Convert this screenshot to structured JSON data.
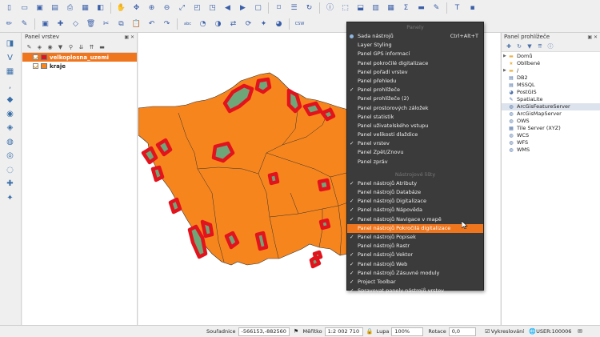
{
  "toolbar": {
    "row1_icons": [
      "new-project-icon",
      "open-project-icon",
      "save-project-icon",
      "save-as-icon",
      "print-layout-icon",
      "layout-manager-icon",
      "style-manager-icon",
      "pan-icon",
      "pan-to-selection-icon",
      "zoom-in-icon",
      "zoom-out-icon",
      "zoom-full-icon",
      "zoom-selection-icon",
      "zoom-layer-icon",
      "zoom-last-icon",
      "zoom-next-icon",
      "new-map-view-icon",
      "bookmark-icon",
      "show-bookmarks-icon",
      "refresh-icon",
      "identify-icon",
      "select-icon",
      "deselect-icon",
      "attribute-table-icon",
      "field-calculator-icon",
      "statistics-icon",
      "measure-icon",
      "annotation-icon",
      "text-annotation-icon",
      "python-icon"
    ],
    "row2_icons": [
      "digitize-icon",
      "toggle-edit-icon",
      "save-edits-icon",
      "add-point-icon",
      "vertex-tool-icon",
      "delete-icon",
      "cut-icon",
      "copy-icon",
      "paste-icon",
      "undo-icon",
      "redo-icon",
      "label-icon",
      "pin-labels-icon",
      "show-labels-icon",
      "move-label-icon",
      "rotate-label-icon",
      "change-label-icon",
      "diagram-icon",
      "csw-icon"
    ]
  },
  "left_tools": [
    "layer-manager-icon",
    "add-vector-icon",
    "add-raster-icon",
    "add-delimited-icon",
    "add-spatialite-icon",
    "add-postgis-icon",
    "add-mssql-icon",
    "add-wms-icon",
    "add-wcs-icon",
    "add-wfs-icon",
    "new-shapefile-icon",
    "new-spatialite-icon"
  ],
  "layers_panel": {
    "title": "Panel vrstev",
    "layers": [
      {
        "name": "velkoplosna_uzemi",
        "color": "#e2131c",
        "selected": true
      },
      {
        "name": "kraje",
        "color": "#f7851d",
        "selected": false
      }
    ]
  },
  "browser_panel": {
    "title": "Panel prohlížeče",
    "items": [
      {
        "label": "Domů",
        "icon": "folder-icon",
        "arrow": true
      },
      {
        "label": "Oblíbené",
        "icon": "star-icon",
        "arrow": false
      },
      {
        "label": "/",
        "icon": "folder-icon",
        "arrow": true
      },
      {
        "label": "DB2",
        "icon": "database-icon",
        "arrow": false
      },
      {
        "label": "MSSQL",
        "icon": "database-icon",
        "arrow": false
      },
      {
        "label": "PostGIS",
        "icon": "elephant-icon",
        "arrow": false
      },
      {
        "label": "SpatiaLite",
        "icon": "feather-icon",
        "arrow": false
      },
      {
        "label": "ArcGisFeatureServer",
        "icon": "globe-icon",
        "arrow": false,
        "selected": true
      },
      {
        "label": "ArcGisMapServer",
        "icon": "globe-icon",
        "arrow": false
      },
      {
        "label": "OWS",
        "icon": "globe-icon",
        "arrow": false
      },
      {
        "label": "Tile Server (XYZ)",
        "icon": "grid-icon",
        "arrow": false
      },
      {
        "label": "WCS",
        "icon": "globe-icon",
        "arrow": false
      },
      {
        "label": "WFS",
        "icon": "globe-icon",
        "arrow": false
      },
      {
        "label": "WMS",
        "icon": "globe-icon",
        "arrow": false
      }
    ]
  },
  "menu": {
    "header_panels": "Panely",
    "header_toolbars": "Nástrojové lišty",
    "items_panels": [
      {
        "label": "Sada nástrojů",
        "shortcut": "Ctrl+Alt+T",
        "mark": "radio"
      },
      {
        "label": "Layer Styling",
        "mark": ""
      },
      {
        "label": "Panel GPS informací",
        "mark": ""
      },
      {
        "label": "Panel pokročilé digitalizace",
        "mark": ""
      },
      {
        "label": "Panel pořadí vrstev",
        "mark": ""
      },
      {
        "label": "Panel přehledu",
        "mark": ""
      },
      {
        "label": "Panel prohlížeče",
        "mark": "check"
      },
      {
        "label": "Panel prohlížeče (2)",
        "mark": ""
      },
      {
        "label": "Panel prostorových záložek",
        "mark": ""
      },
      {
        "label": "Panel statistik",
        "mark": ""
      },
      {
        "label": "Panel uživatelského vstupu",
        "mark": ""
      },
      {
        "label": "Panel velikosti dlaždice",
        "mark": ""
      },
      {
        "label": "Panel vrstev",
        "mark": "check"
      },
      {
        "label": "Panel Zpět/Znovu",
        "mark": ""
      },
      {
        "label": "Panel zpráv",
        "mark": ""
      }
    ],
    "items_toolbars": [
      {
        "label": "Panel nástrojů Atributy",
        "mark": "check"
      },
      {
        "label": "Panel nástrojů Databáze",
        "mark": ""
      },
      {
        "label": "Panel nástrojů Digitalizace",
        "mark": "check"
      },
      {
        "label": "Panel nástrojů Nápověda",
        "mark": "check"
      },
      {
        "label": "Panel nástrojů Navigace v mapě",
        "mark": "check"
      },
      {
        "label": "Panel nástrojů Pokročilá digitalizace",
        "mark": "",
        "highlight": true
      },
      {
        "label": "Panel nástrojů Popisek",
        "mark": "check"
      },
      {
        "label": "Panel nástrojů Rastr",
        "mark": ""
      },
      {
        "label": "Panel nástrojů Vektor",
        "mark": "check"
      },
      {
        "label": "Panel nástrojů Web",
        "mark": "check"
      },
      {
        "label": "Panel nástrojů Zásuvné moduly",
        "mark": "check"
      },
      {
        "label": "Project Toolbar",
        "mark": "check"
      },
      {
        "label": "Spravovat panely nástrojů vrstev",
        "mark": "check"
      }
    ]
  },
  "statusbar": {
    "coord_label": "Souřadnice",
    "coord_value": "-566153,-882560",
    "scale_label": "Měřítko",
    "scale_value": "1:2 002 710",
    "magnifier_label": "Lupa",
    "magnifier_value": "100%",
    "rotation_label": "Rotace",
    "rotation_value": "0,0",
    "render_label": "Vykreslování",
    "crs_label": "USER:100006"
  },
  "colors": {
    "region_fill": "#f7851d",
    "protected_area_fill": "#6ea67a",
    "protected_area_border": "#e2131c",
    "menu_highlight": "#f0761e"
  }
}
